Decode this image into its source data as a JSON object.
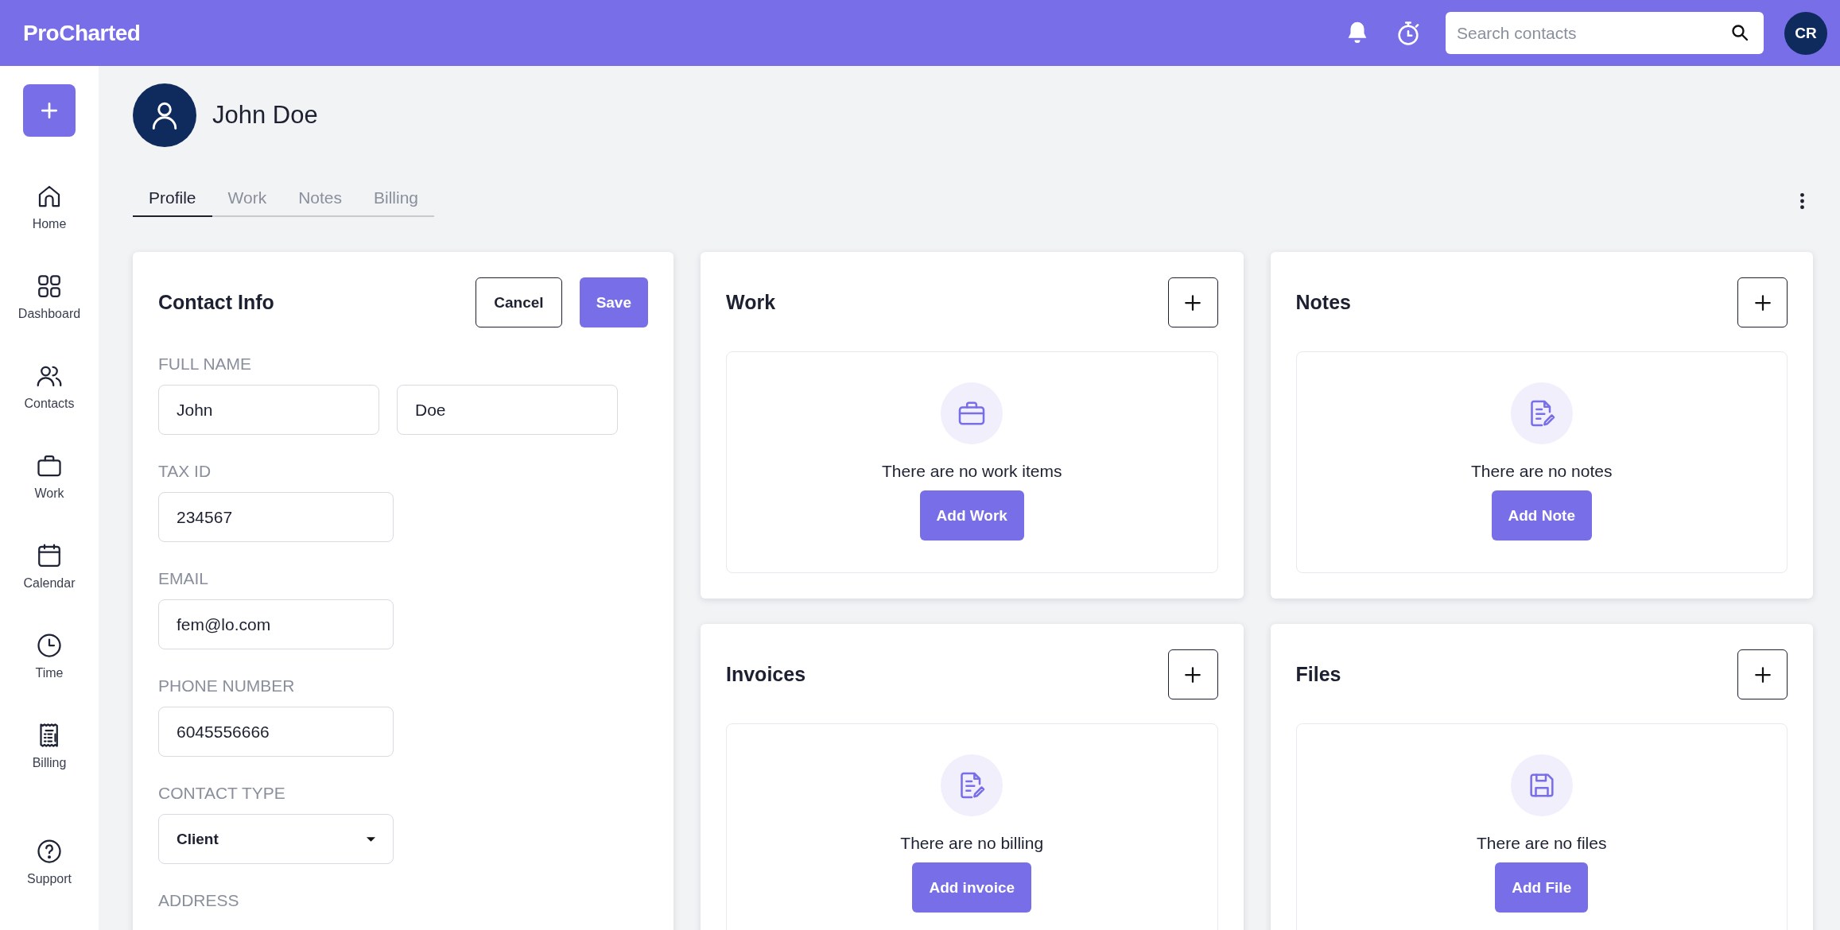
{
  "header": {
    "logo": "ProCharted",
    "search": {
      "placeholder": "Search contacts"
    },
    "avatar": "CR"
  },
  "sidebar": {
    "items": [
      {
        "kind": "home",
        "label": "Home"
      },
      {
        "kind": "dashboard",
        "label": "Dashboard"
      },
      {
        "kind": "contacts",
        "label": "Contacts"
      },
      {
        "kind": "work",
        "label": "Work"
      },
      {
        "kind": "calendar",
        "label": "Calendar"
      },
      {
        "kind": "time",
        "label": "Time"
      },
      {
        "kind": "billing",
        "label": "Billing"
      }
    ],
    "footer_items": [
      {
        "kind": "support",
        "label": "Support"
      }
    ]
  },
  "contact": {
    "name": "John Doe"
  },
  "tabs": [
    {
      "label": "Profile",
      "selected": true
    },
    {
      "label": "Work",
      "selected": false
    },
    {
      "label": "Notes",
      "selected": false
    },
    {
      "label": "Billing",
      "selected": false
    }
  ],
  "contact_info": {
    "title": "Contact Info",
    "buttons": {
      "cancel": "Cancel",
      "save": "Save"
    },
    "fields": [
      {
        "kind": "pair",
        "label": "FULL NAME",
        "values": [
          "John",
          "Doe"
        ]
      },
      {
        "kind": "text",
        "label": "TAX ID",
        "value": "234567"
      },
      {
        "kind": "text",
        "label": "EMAIL",
        "value": "fem@lo.com"
      },
      {
        "kind": "text",
        "label": "PHONE NUMBER",
        "value": "6045556666"
      },
      {
        "kind": "select",
        "label": "CONTACT TYPE",
        "value": "Client"
      },
      {
        "kind": "label",
        "label": "ADDRESS"
      }
    ]
  },
  "columns": [
    [
      {
        "title": "Work",
        "kind": "briefcase",
        "empty_text": "There are no work items",
        "button": "Add Work"
      },
      {
        "title": "Invoices",
        "kind": "document",
        "empty_text": "There are no billing",
        "button": "Add invoice"
      }
    ],
    [
      {
        "title": "Notes",
        "kind": "document",
        "empty_text": "There are no notes",
        "button": "Add Note"
      },
      {
        "title": "Files",
        "kind": "floppy",
        "empty_text": "There are no files",
        "button": "Add File"
      }
    ]
  ]
}
